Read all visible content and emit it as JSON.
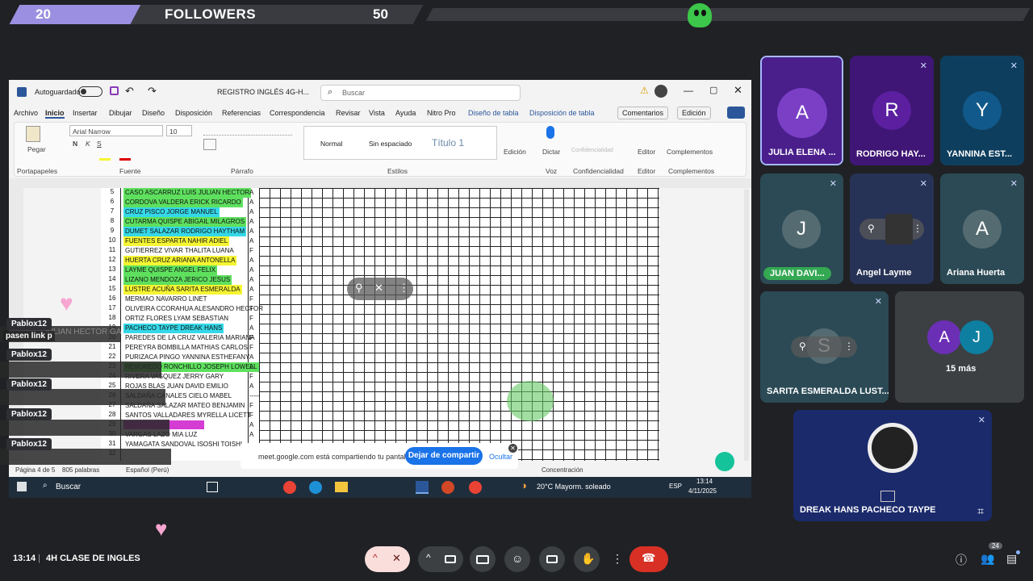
{
  "followers": {
    "current": "20",
    "label": "FOLLOWERS",
    "goal": "50"
  },
  "doc": {
    "autosave": "Autoguardado",
    "filename": "REGISTRO INGLÉS 4G-H...",
    "search_placeholder": "Buscar",
    "tabs": [
      "Archivo",
      "Inicio",
      "Insertar",
      "Dibujar",
      "Diseño",
      "Disposición",
      "Referencias",
      "Correspondencia",
      "Revisar",
      "Vista",
      "Ayuda",
      "Nitro Pro",
      "Diseño de tabla",
      "Disposición de tabla"
    ],
    "comments": "Comentarios",
    "edit_mode": "Edición",
    "ribbon": {
      "paste": "Pegar",
      "clipboard": "Portapapeles",
      "font_name": "Arial Narrow",
      "font_size": "10",
      "font_group": "Fuente",
      "paragraph_group": "Párrafo",
      "style_normal": "Normal",
      "style_nospace": "Sin espaciado",
      "style_title": "Título 1",
      "styles_group": "Estilos",
      "edit": "Edición",
      "dictate": "Dictar",
      "voice": "Voz",
      "confidentiality": "Confidencialidad",
      "editor": "Editor",
      "addins": "Complementos"
    },
    "rows": [
      {
        "n": "5",
        "name": "CASO ASCARRUZ LUIS JULIAN HECTOR",
        "g": "A",
        "hl": "#5ee05e"
      },
      {
        "n": "6",
        "name": "CORDOVA VALDERA ERICK RICARDO",
        "g": "A",
        "hl": "#5ee05e"
      },
      {
        "n": "7",
        "name": "CRUZ PISCO JORGE MANUEL",
        "g": "A",
        "hl": "#35d8e8"
      },
      {
        "n": "8",
        "name": "CUTARMA QUISPE ABIGAIL MILAGROS",
        "g": "A",
        "hl": "#5ee05e"
      },
      {
        "n": "9",
        "name": "DUMET SALAZAR RODRIGO HAYTHAM",
        "g": "A",
        "hl": "#35d8e8"
      },
      {
        "n": "10",
        "name": "FUENTES ESPARTA NAHIR ADIEL",
        "g": "A",
        "hl": "#f5f533"
      },
      {
        "n": "11",
        "name": "GUTIERREZ VIVAR THALITA LUANA",
        "g": "F",
        "hl": ""
      },
      {
        "n": "12",
        "name": "HUERTA CRUZ ARIANA ANTONELLA",
        "g": "A",
        "hl": "#f5f533"
      },
      {
        "n": "13",
        "name": "LAYME QUISPE ANGEL FELIX",
        "g": "A",
        "hl": "#5ee05e"
      },
      {
        "n": "14",
        "name": "LIZANO MENDOZA JERICO JESUS",
        "g": "A",
        "hl": "#5ee05e"
      },
      {
        "n": "15",
        "name": "LUSTRE ACUÑA SARITA ESMERALDA",
        "g": "A",
        "hl": "#f5f533"
      },
      {
        "n": "16",
        "name": "MERMAO NAVARRO LINET",
        "g": "F",
        "hl": ""
      },
      {
        "n": "17",
        "name": "OLIVEIRA CCORAHUA ALESANDRO HECTOR",
        "g": "F",
        "hl": ""
      },
      {
        "n": "18",
        "name": "ORTIZ FLORES LYAM SEBASTIAN",
        "g": "F",
        "hl": ""
      },
      {
        "n": "19",
        "name": "PACHECO TAYPE DREAK HANS",
        "g": "A",
        "hl": "#35d8e8"
      },
      {
        "n": "20",
        "name": "PAREDES DE LA CRUZ VALERIA MARIANA",
        "g": "F",
        "hl": ""
      },
      {
        "n": "21",
        "name": "PEREYRA BOMBILLA MATHIAS CARLOS",
        "g": "F",
        "hl": ""
      },
      {
        "n": "22",
        "name": "PURIZACA PINGO YANNINA ESTHEFANY",
        "g": "A",
        "hl": ""
      },
      {
        "n": "23",
        "name": "REVOREDO RONCHILLO JOSEPH LOWELL",
        "g": "A",
        "hl": "#5ee05e"
      },
      {
        "n": "24",
        "name": "RIVERA VASQUEZ JERRY GARY",
        "g": "F",
        "hl": ""
      },
      {
        "n": "25",
        "name": "ROJAS BLAS JUAN DAVID EMILIO",
        "g": "A",
        "hl": ""
      },
      {
        "n": "26",
        "name": "SALDAÑA CANALES CIELO MABEL",
        "g": "-----",
        "hl": ""
      },
      {
        "n": "27",
        "name": "SALDAÑA SALAZAR MATEO BENJAMIN",
        "g": "F",
        "hl": ""
      },
      {
        "n": "28",
        "name": "SANTOS VALLADARES MYRELLA LICETT",
        "g": "F",
        "hl": ""
      },
      {
        "n": "29",
        "name": "",
        "g": "A",
        "hl": "#d43cd4"
      },
      {
        "n": "30",
        "name": "VARGAS LAZO MIA LUZ",
        "g": "A",
        "hl": ""
      },
      {
        "n": "31",
        "name": "YAMAGATA SANDOVAL ISOSHI TOISHI",
        "g": "",
        "hl": ""
      },
      {
        "n": "32",
        "name": "",
        "g": "",
        "hl": ""
      }
    ],
    "status": {
      "page": "Página 4 de 5",
      "words": "805 palabras",
      "lang": "Español (Perú)",
      "focus": "Concentración"
    },
    "taskbar": {
      "search": "Buscar",
      "weather": "20°C  Mayorm. soleado",
      "lang": "ESP",
      "time": "13:14",
      "date": "4/11/2025"
    }
  },
  "toast": {
    "message": "meet.google.com está compartiendo tu pantalla.",
    "stop": "Dejar de compartir",
    "hide": "Ocultar"
  },
  "chat": {
    "user": "Pablox12",
    "ghost_name": "JULIAN HECTOR GA",
    "message": "pasen link p"
  },
  "participants": [
    {
      "name": "JULIA ELENA ...",
      "initial": "A",
      "color": "#7b3fc6",
      "bg": "#4a1f8c"
    },
    {
      "name": "RODRIGO HAY...",
      "initial": "R",
      "color": "#5b1fa0",
      "bg": "#3f1675"
    },
    {
      "name": "YANNINA EST...",
      "initial": "Y",
      "color": "#11598a",
      "bg": "#0e3e5e"
    },
    {
      "name": "JUAN DAVI...",
      "initial": "J",
      "color": "#556b72",
      "bg": "#2b4a55"
    },
    {
      "name": "Angel Layme",
      "initial": "",
      "color": "#333",
      "bg": "#273356"
    },
    {
      "name": "Ariana Huerta",
      "initial": "A",
      "color": "#556b72",
      "bg": "#2b4a55"
    },
    {
      "name": "SARITA ESMERALDA LUST...",
      "initial": "S",
      "color": "#556b72",
      "bg": "#2b4a55"
    },
    {
      "name": "15 más",
      "initial": "",
      "color": "",
      "bg": "#3c4043"
    },
    {
      "name": "DREAK HANS PACHECO TAYPE",
      "initial": "",
      "color": "",
      "bg": "#1b2a6b"
    }
  ],
  "more_avatars": [
    "A",
    "J"
  ],
  "meeting": {
    "time": "13:14",
    "title": "4H CLASE DE INGLES",
    "people_count": "24"
  }
}
